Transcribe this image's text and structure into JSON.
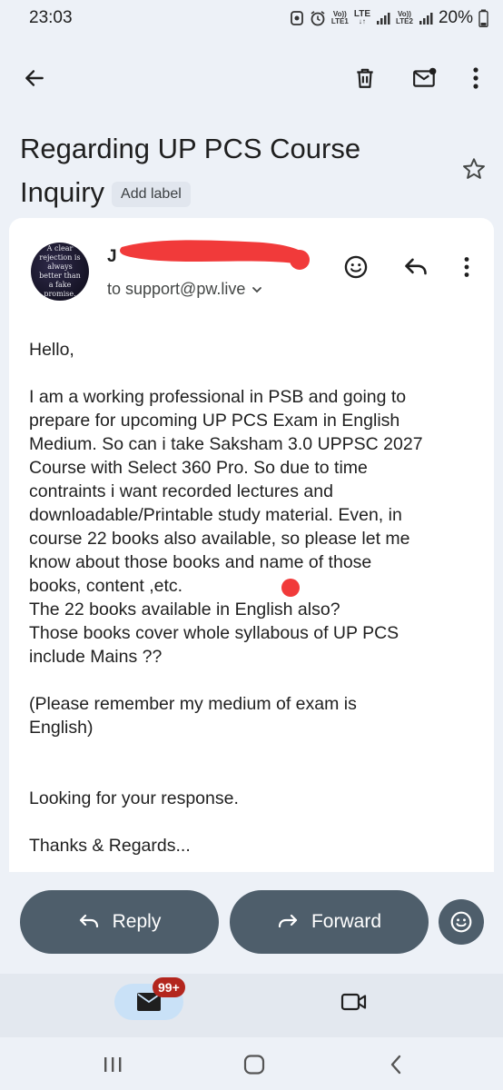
{
  "status_bar": {
    "time": "23:03",
    "sim1_top": "Vo))",
    "sim1_bottom": "LTE1",
    "network": "LTE",
    "sim2_top": "Vo))",
    "sim2_bottom": "LTE2",
    "battery": "20%"
  },
  "app_bar": {
    "icons": [
      "back-arrow-icon",
      "delete-icon",
      "mark-unread-icon",
      "more-vert-icon"
    ]
  },
  "email": {
    "subject": "Regarding UP PCS Course Inquiry",
    "label_button": "Add label",
    "sender_visible": "J",
    "avatar_text": "A clear rejection is always better than a fake promise.",
    "to_line": "to support@pw.live",
    "body": {
      "greeting": "Hello,",
      "lines": [
        "I am a working professional in PSB and going to",
        "prepare for upcoming UP PCS Exam in English",
        "Medium. So can i take Saksham 3.0 UPPSC 2027",
        "Course with Select 360 Pro. So due to time",
        "contraints i want recorded lectures and",
        "downloadable/Printable study material. Even, in",
        "course 22 books also available, so please let me",
        "know about those books and name of those",
        "books, content ,etc.",
        "The 22 books available in English also?",
        "Those books cover whole syllabous of UP PCS",
        "include Mains ??"
      ],
      "note_lines": [
        "(Please remember my medium of exam is",
        "English)"
      ],
      "closing": "Looking for your response.",
      "signoff": "Thanks & Regards..."
    }
  },
  "actions": {
    "reply_label": "Reply",
    "forward_label": "Forward"
  },
  "bottom_nav": {
    "mail_badge": "99+"
  },
  "colors": {
    "background": "#edf1f7",
    "action_pill": "#4e5e6b",
    "mail_tab_active": "#c9e1f7",
    "badge": "#b3261e",
    "redaction": "#f13a3a"
  }
}
